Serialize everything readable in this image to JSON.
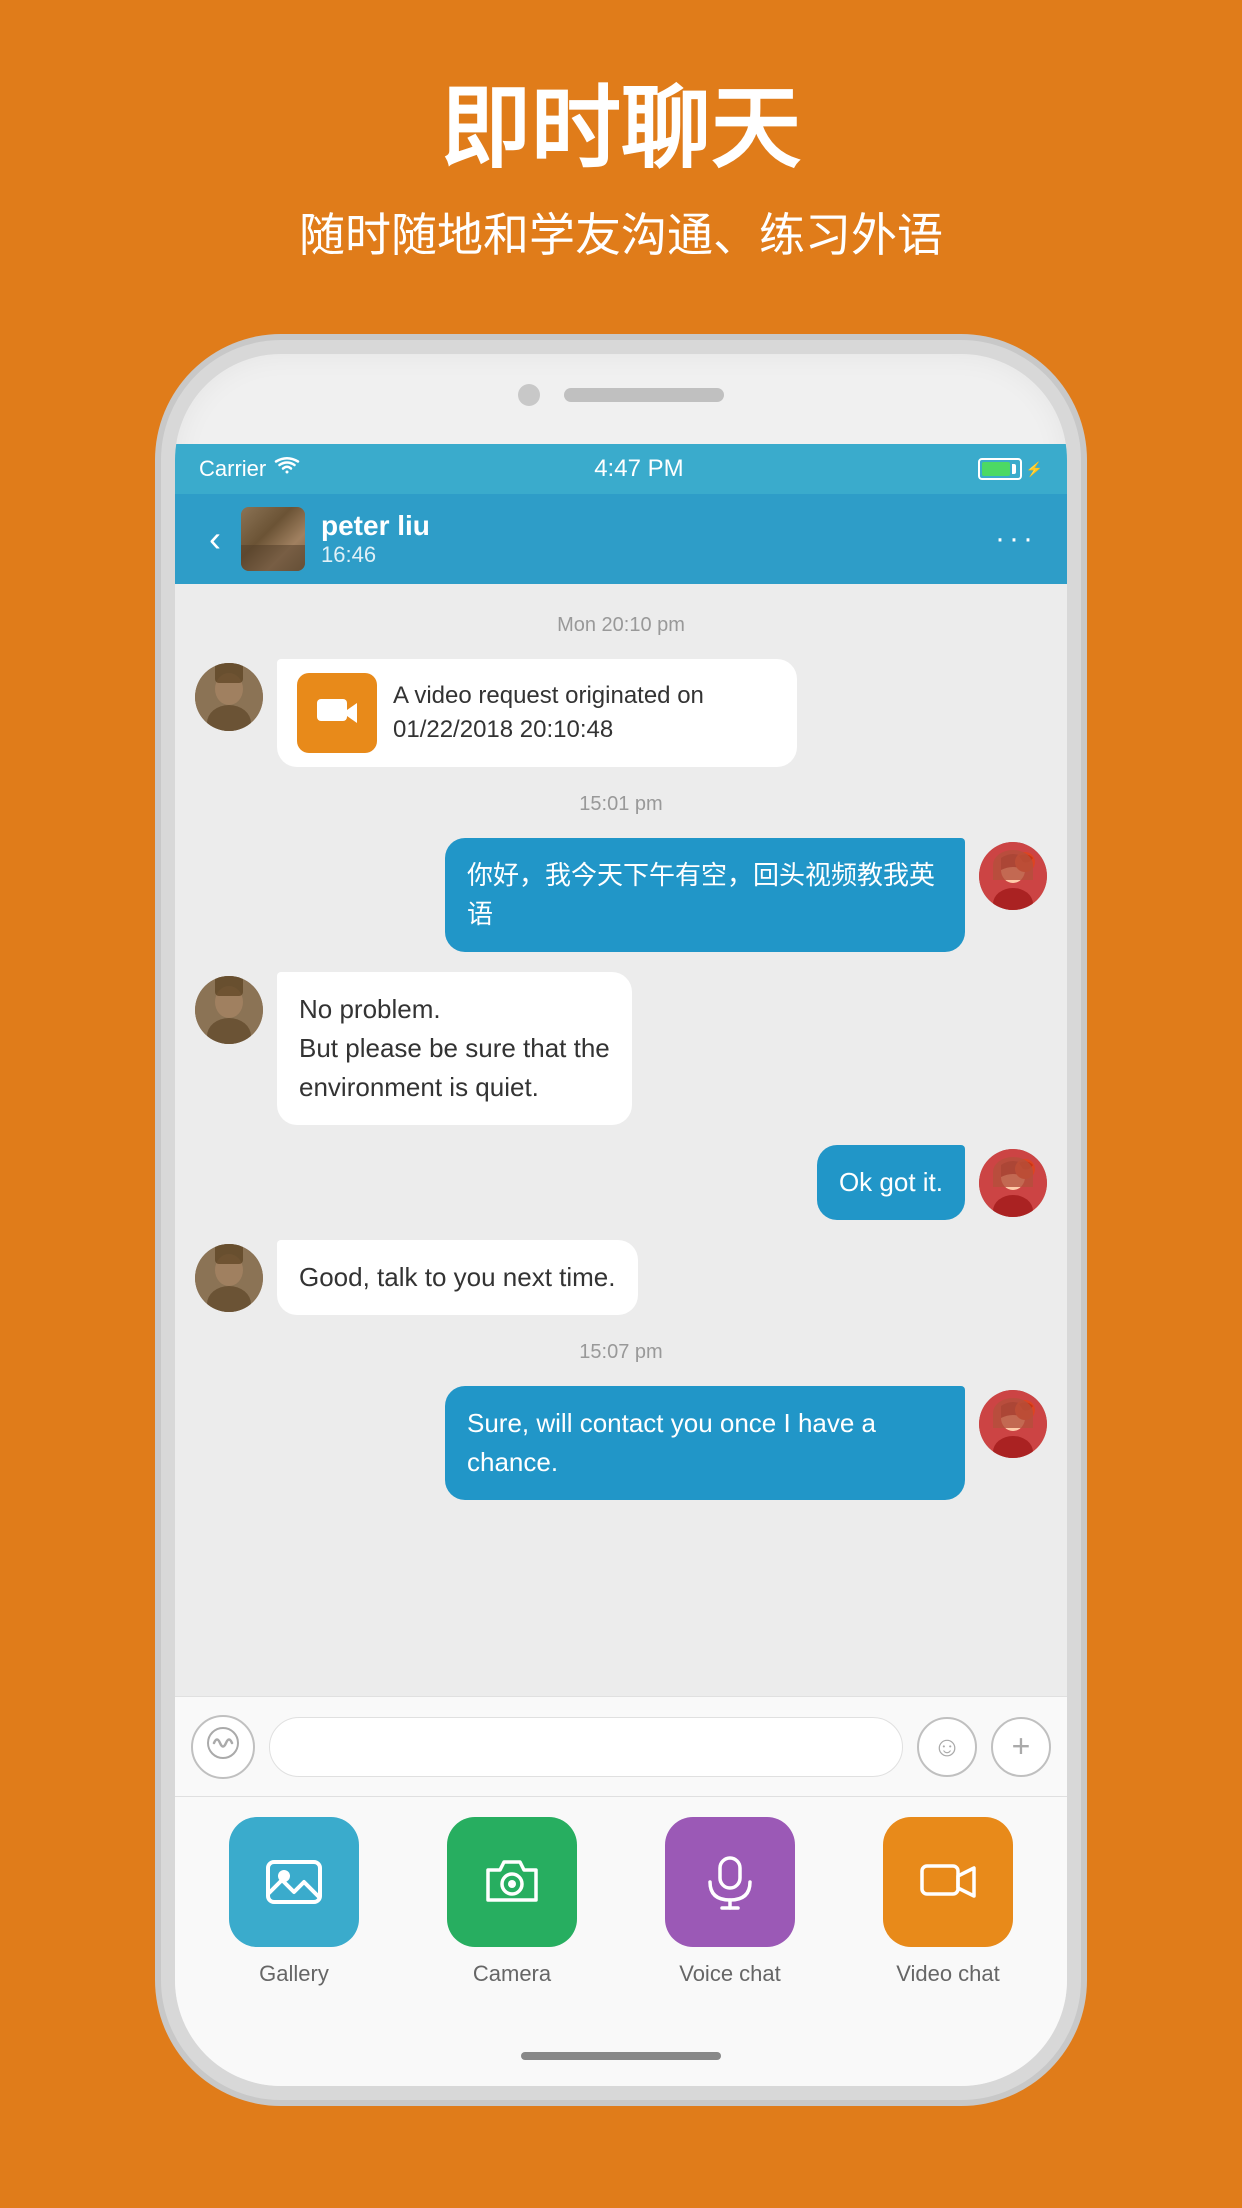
{
  "header": {
    "title": "即时聊天",
    "subtitle": "随时随地和学友沟通、练习外语"
  },
  "statusBar": {
    "carrier": "Carrier",
    "time": "4:47 PM"
  },
  "navBar": {
    "username": "peter liu",
    "lastSeen": "16:46",
    "moreIcon": "···"
  },
  "chat": {
    "timestamps": {
      "t1": "Mon 20:10 pm",
      "t2": "15:01 pm",
      "t3": "15:07 pm"
    },
    "messages": [
      {
        "id": "msg1",
        "type": "video-request",
        "sender": "peter",
        "text": "A video request originated on 01/22/2018 20:10:48"
      },
      {
        "id": "msg2",
        "type": "sent",
        "text": "你好，我今天下午有空，回头视频教我英语"
      },
      {
        "id": "msg3",
        "type": "received",
        "sender": "peter",
        "text": "No  problem.\nBut  please be sure that the environment is  quiet."
      },
      {
        "id": "msg4",
        "type": "sent",
        "text": "Ok got it."
      },
      {
        "id": "msg5",
        "type": "received",
        "sender": "peter",
        "text": "Good, talk  to you next time."
      },
      {
        "id": "msg6",
        "type": "sent",
        "text": "Sure, will contact you once I have a chance."
      }
    ]
  },
  "inputBar": {
    "placeholder": ""
  },
  "actionBar": {
    "items": [
      {
        "id": "gallery",
        "label": "Gallery",
        "color": "#3AABCC"
      },
      {
        "id": "camera",
        "label": "Camera",
        "color": "#27AE60"
      },
      {
        "id": "voicechat",
        "label": "Voice chat",
        "color": "#9B59B6"
      },
      {
        "id": "videochat",
        "label": "Video chat",
        "color": "#E88A1A"
      }
    ]
  }
}
